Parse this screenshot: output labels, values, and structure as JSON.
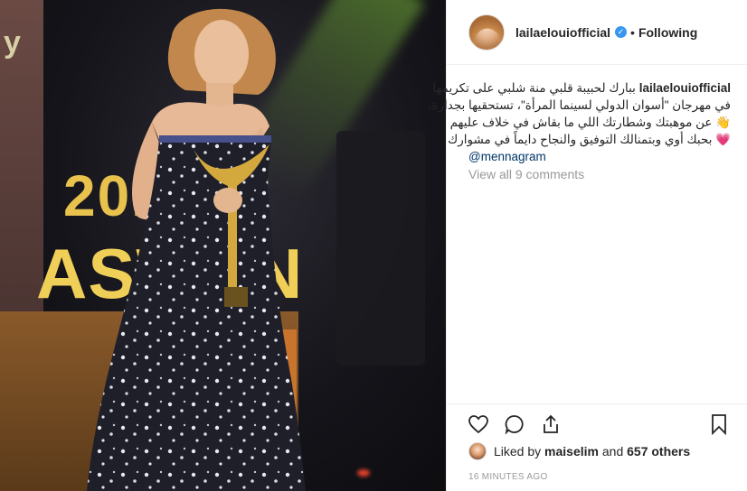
{
  "post": {
    "username": "lailaelouiofficial",
    "verified_badge": "✓",
    "separator": "•",
    "follow_state": "Following"
  },
  "caption": {
    "username": "lailaelouiofficial",
    "line1_text": "ببارك لحبيبة قلبي منة شلبي على تكريمها",
    "line2": "في مهرجان \"أسوان الدولي لسينما المرأة\"، تستحقيها بجدارة،",
    "line3": "👋 عن موهبتك وشطارتك اللي ما بقاش في خلاف عليهم",
    "line4": "💗 بحبك أوي وبتمنالك التوفيق والنجاح دايماً في مشوارك",
    "mention": "@mennagram"
  },
  "view_comments": "View all 9 comments",
  "likes": {
    "prefix": "Liked by ",
    "user": "maiselim",
    "middle": " and ",
    "count_text": "657 others"
  },
  "timestamp": "16 MINUTES AGO",
  "photo": {
    "sign_number": "2019",
    "sign_word": "ASWAN",
    "corner_text": "y"
  },
  "icons": {
    "like": "heart-icon",
    "comment": "comment-icon",
    "share": "share-icon",
    "save": "bookmark-icon"
  },
  "colors": {
    "accent_blue": "#3897f0",
    "mention": "#003569",
    "muted": "#999999",
    "text": "#262626"
  }
}
